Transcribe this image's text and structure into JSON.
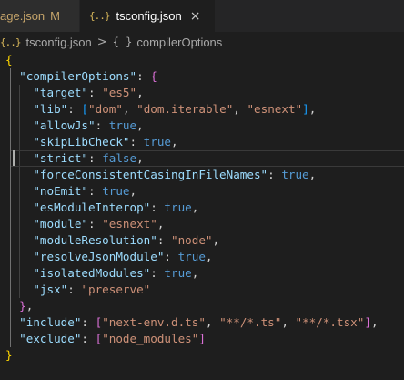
{
  "tabs": [
    {
      "label": "age.json",
      "status": "M",
      "active": false
    },
    {
      "icon": "{..}",
      "label": "tsconfig.json",
      "close": "×",
      "active": true
    }
  ],
  "breadcrumb": {
    "file_icon": "{..}",
    "file": "tsconfig.json",
    "separator": ">",
    "symbol_icon": "{ }",
    "symbol": "compilerOptions"
  },
  "code": {
    "compilerOptions_key": "\"compilerOptions\"",
    "options": [
      {
        "key": "\"target\"",
        "value": "\"es5\""
      },
      {
        "key": "\"allowJs\"",
        "value": "true"
      },
      {
        "key": "\"skipLibCheck\"",
        "value": "true"
      },
      {
        "key": "\"strict\"",
        "value": "false"
      },
      {
        "key": "\"forceConsistentCasingInFileNames\"",
        "value": "true"
      },
      {
        "key": "\"noEmit\"",
        "value": "true"
      },
      {
        "key": "\"esModuleInterop\"",
        "value": "true"
      },
      {
        "key": "\"module\"",
        "value": "\"esnext\""
      },
      {
        "key": "\"moduleResolution\"",
        "value": "\"node\""
      },
      {
        "key": "\"resolveJsonModule\"",
        "value": "true"
      },
      {
        "key": "\"isolatedModules\"",
        "value": "true"
      },
      {
        "key": "\"jsx\"",
        "value": "\"preserve\""
      }
    ],
    "lib_key": "\"lib\"",
    "lib_values": [
      "\"dom\"",
      "\"dom.iterable\"",
      "\"esnext\""
    ],
    "include_key": "\"include\"",
    "include_values": [
      "\"next-env.d.ts\"",
      "\"**/*.ts\"",
      "\"**/*.tsx\""
    ],
    "exclude_key": "\"exclude\"",
    "exclude_values": [
      "\"node_modules\""
    ]
  },
  "colors": {
    "background": "#1e1e1e",
    "key": "#9cdcfe",
    "string": "#ce9178",
    "keyword": "#569cd6",
    "brace_outer": "#ffd700",
    "brace_inner": "#da70d6",
    "bracket": "#179fff",
    "modified": "#c5a46a"
  }
}
